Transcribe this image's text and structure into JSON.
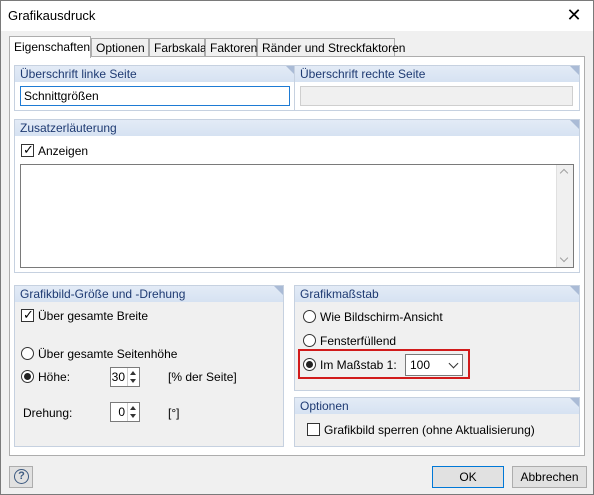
{
  "window": {
    "title": "Grafikausdruck"
  },
  "tabs": [
    {
      "label": "Eigenschaften"
    },
    {
      "label": "Optionen"
    },
    {
      "label": "Farbskala"
    },
    {
      "label": "Faktoren"
    },
    {
      "label": "Ränder und Streckfaktoren"
    }
  ],
  "headings": {
    "left_header": "Überschrift linke Seite",
    "right_header": "Überschrift rechte Seite",
    "left_header_value": "Schnittgrößen",
    "right_header_value": ""
  },
  "extra_notes": {
    "title": "Zusatzerläuterung",
    "show_label": "Anzeigen",
    "show_checked": true,
    "text": ""
  },
  "size_rotation": {
    "title": "Grafikbild-Größe und -Drehung",
    "full_width_label": "Über gesamte Breite",
    "full_width_checked": true,
    "full_height_label": "Über gesamte Seitenhöhe",
    "height_label": "Höhe:",
    "height_value": "30",
    "height_unit": "[% der Seite]",
    "rotation_label": "Drehung:",
    "rotation_value": "0",
    "rotation_unit": "[°]"
  },
  "scale": {
    "title": "Grafikmaßstab",
    "screen_view_label": "Wie Bildschirm-Ansicht",
    "fill_window_label": "Fensterfüllend",
    "scale_label": "Im Maßstab 1:",
    "scale_value": "100"
  },
  "options": {
    "title": "Optionen",
    "lock_label": "Grafikbild sperren (ohne Aktualisierung)"
  },
  "buttons": {
    "ok": "OK",
    "cancel": "Abbrechen"
  },
  "colors": {
    "group_header_text": "#1e3a72",
    "highlight": "#d11b1b",
    "focus": "#1e7bd4"
  }
}
